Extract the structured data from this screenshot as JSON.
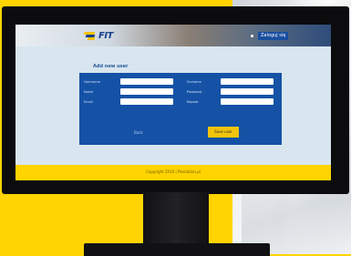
{
  "scene": {
    "background_color": "#ffd400",
    "screen_bg_color": "#d9e6ef"
  },
  "header": {
    "logo_text": "FIT",
    "nav_link_label": "Sign up",
    "nav_button_label": "Zaloguj się"
  },
  "form": {
    "title": "Add new user",
    "fields_left": [
      {
        "label": "Username",
        "value": ""
      },
      {
        "label": "Name",
        "value": ""
      },
      {
        "label": "Email",
        "value": ""
      }
    ],
    "fields_right": [
      {
        "label": "Surname",
        "value": ""
      },
      {
        "label": "Password",
        "value": ""
      },
      {
        "label": "Repeat",
        "value": ""
      }
    ],
    "back_label": "Back",
    "submit_label": "Save user"
  },
  "footer": {
    "copyright": "Copyright 2016 | fitsolution.pl"
  },
  "colors": {
    "panel": "#1552a6",
    "accent_yellow": "#ffd400",
    "button_yellow": "#f2c40c"
  }
}
